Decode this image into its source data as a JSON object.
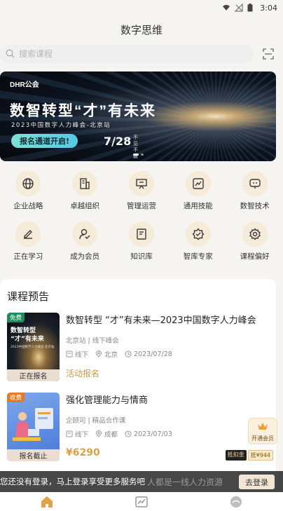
{
  "status_bar": {
    "time": "3:04",
    "icons": [
      "wifi-icon",
      "no-signal-icon",
      "battery-icon"
    ]
  },
  "header": {
    "title": "数字思维"
  },
  "search": {
    "placeholder": "搜索课程",
    "icon": "search-icon",
    "scan_icon": "scan-icon"
  },
  "banner": {
    "brand": "DHR公会",
    "headline": "数智转型“才”有未来",
    "subline": "2023中国数字人力峰会-北京站",
    "cta": "报名通道开启!",
    "date": "7/28",
    "date_sub": "不见不散"
  },
  "categories": [
    {
      "label": "企业战略",
      "icon": "globe-icon"
    },
    {
      "label": "卓越组织",
      "icon": "building-icon"
    },
    {
      "label": "管理运营",
      "icon": "presentation-icon"
    },
    {
      "label": "通用技能",
      "icon": "chart-icon"
    },
    {
      "label": "数智技术",
      "icon": "robot-icon"
    },
    {
      "label": "正在学习",
      "icon": "edit-icon"
    },
    {
      "label": "成为会员",
      "icon": "member-icon"
    },
    {
      "label": "知识库",
      "icon": "book-icon"
    },
    {
      "label": "智库专家",
      "icon": "expert-icon"
    },
    {
      "label": "课程偏好",
      "icon": "settings-icon"
    }
  ],
  "course_preview": {
    "title": "课程预告",
    "items": [
      {
        "badge": "免费",
        "thumb_status": "正在报名",
        "title": "数智转型 “才”有未来—2023中国数字人力峰会",
        "meta": "北京站 | 线下峰会",
        "mode": "线下",
        "location": "北京",
        "date": "2023/07/28",
        "action": "活动报名",
        "thumb_text": "数智转型 “才”有未来",
        "thumb_subtext": "2023中国数字人力峰会·北京站"
      },
      {
        "badge": "收费",
        "thumb_status": "报名截止",
        "title": "强化管理能力与情商",
        "meta": "企顾司 | 精品合作课",
        "mode": "线下",
        "location": "成都",
        "date": "2023/07/03",
        "price": "¥6290"
      }
    ]
  },
  "vip": {
    "label": "开通会员",
    "tag1": "抵扣金",
    "tag2": "抵¥944"
  },
  "login_prompt": {
    "text": "您还没有登录，马上登录享受更多服务吧",
    "background_text": "人都是一线人力资源",
    "button": "去登录"
  },
  "tabbar": {
    "tabs": [
      {
        "icon": "home-icon",
        "active": true
      },
      {
        "icon": "trend-icon",
        "active": false
      },
      {
        "icon": "profile-icon",
        "active": false
      }
    ]
  },
  "colors": {
    "accent": "#d8a14d",
    "category_bg": "#f6ead8",
    "free_badge": "#1f8c5b",
    "paid_badge": "#e37b26"
  }
}
